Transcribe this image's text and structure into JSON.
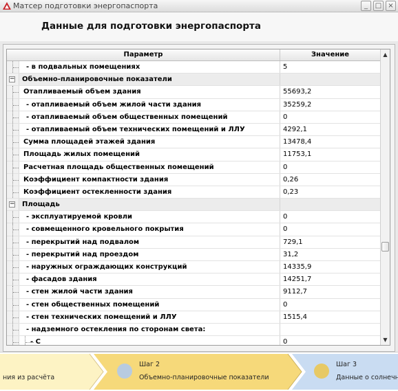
{
  "window": {
    "title": "Матсер подготовки энергопаспорта",
    "controls": [
      "_",
      "□",
      "×"
    ]
  },
  "header": {
    "title": "Данные для подготовки энергопаспорта"
  },
  "table": {
    "columns": {
      "param": "Параметр",
      "value": "Значение"
    },
    "rows": [
      {
        "label": "- в подвальных помещениях",
        "value": "5",
        "kind": "child"
      },
      {
        "label": "Объемно-планировочные показатели",
        "value": "",
        "kind": "group",
        "expander": "−"
      },
      {
        "label": "Отапливаемый объем здания",
        "value": "55693,2",
        "kind": "item"
      },
      {
        "label": "- отапливаемый объем жилой части здания",
        "value": "35259,2",
        "kind": "child"
      },
      {
        "label": "- отапливаемый объем общественных помещений",
        "value": "0",
        "kind": "child"
      },
      {
        "label": "- отапливаемый объем технических помещений и ЛЛУ",
        "value": "4292,1",
        "kind": "child"
      },
      {
        "label": "Сумма площадей этажей здания",
        "value": "13478,4",
        "kind": "item"
      },
      {
        "label": "Площадь жилых помещений",
        "value": "11753,1",
        "kind": "item"
      },
      {
        "label": "Расчетная площадь общественных помещений",
        "value": "0",
        "kind": "item"
      },
      {
        "label": "Коэффициент компактности здания",
        "value": "0,26",
        "kind": "item"
      },
      {
        "label": "Коэффициент остекленности здания",
        "value": "0,23",
        "kind": "item"
      },
      {
        "label": "Площадь",
        "value": "",
        "kind": "group",
        "expander": "−"
      },
      {
        "label": "- эксплуатируемой кровли",
        "value": "0",
        "kind": "child"
      },
      {
        "label": "- совмещенного кровельного покрытия",
        "value": "0",
        "kind": "child"
      },
      {
        "label": "- перекрытий над подвалом",
        "value": "729,1",
        "kind": "child"
      },
      {
        "label": "- перекрытий над проездом",
        "value": "31,2",
        "kind": "child"
      },
      {
        "label": "- наружных ограждающих конструкций",
        "value": "14335,9",
        "kind": "child"
      },
      {
        "label": "- фасадов здания",
        "value": "14251,7",
        "kind": "child"
      },
      {
        "label": "- стен жилой части здания",
        "value": "9112,7",
        "kind": "child"
      },
      {
        "label": "- стен общественных помещений",
        "value": "0",
        "kind": "child"
      },
      {
        "label": "- стен технических помещений и ЛЛУ",
        "value": "1515,4",
        "kind": "child"
      },
      {
        "label": "- надземного остекления по сторонам света:",
        "value": "",
        "kind": "child"
      },
      {
        "label": "- С",
        "value": "0",
        "kind": "subchild"
      }
    ]
  },
  "steps": {
    "step1": {
      "text": "ния из расчёта"
    },
    "step2": {
      "number": "Шаг 2",
      "text": "Объемно-планировочные показатели"
    },
    "step3": {
      "number": "Шаг 3",
      "text": "Данные о солнечно"
    }
  },
  "colors": {
    "step1_bg": "#fdf3c4",
    "step2_bg": "#f6d97a",
    "step3_bg": "#c9dcf2",
    "step2_circle": "#b8cbe0",
    "step3_circle": "#e7c965",
    "logo_red": "#c8242a"
  }
}
